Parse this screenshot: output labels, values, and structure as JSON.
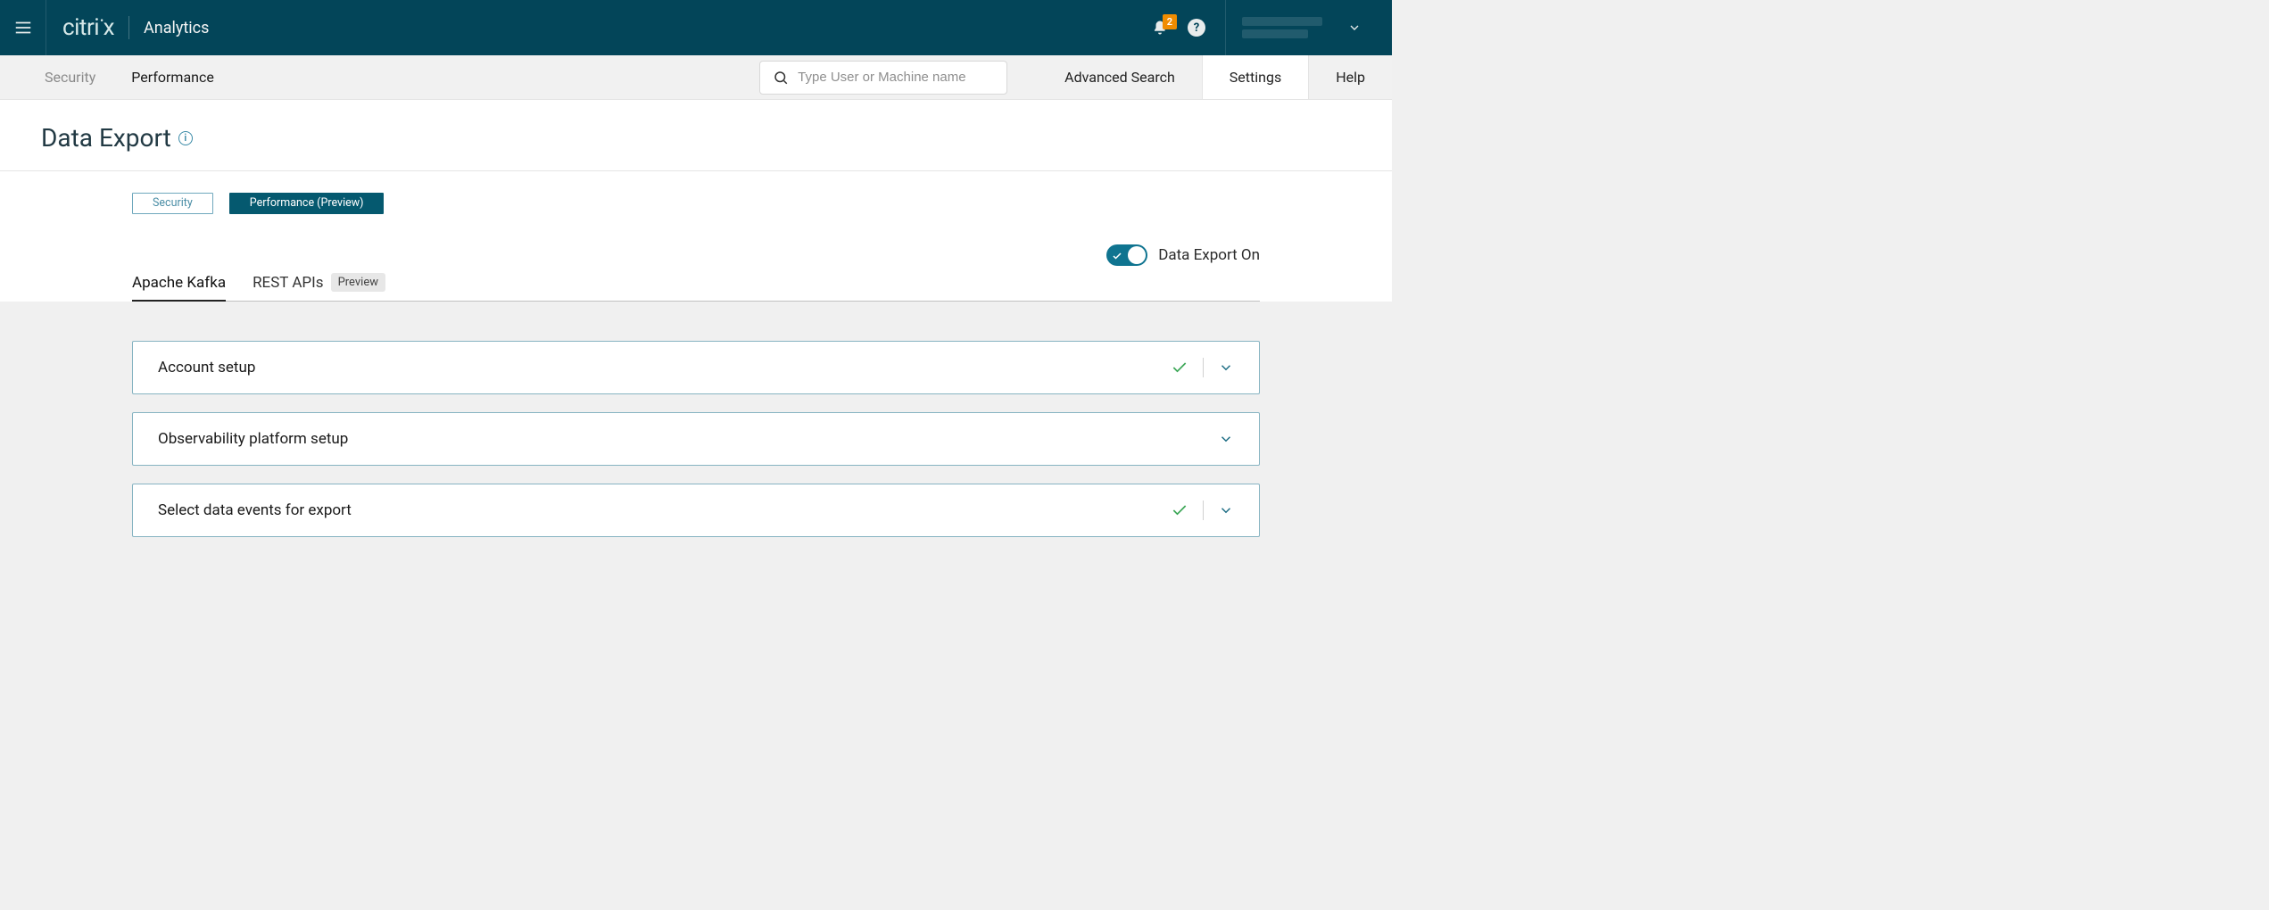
{
  "brand": {
    "logo_text": "citri",
    "logo_dot": "•",
    "logo_x": "x",
    "product": "Analytics"
  },
  "notifications": {
    "count": "2"
  },
  "secnav": {
    "tabs": {
      "security": "Security",
      "performance": "Performance"
    },
    "search_placeholder": "Type User or Machine name",
    "links": {
      "advanced": "Advanced Search",
      "settings": "Settings",
      "help": "Help"
    }
  },
  "page": {
    "title": "Data Export"
  },
  "pill_tabs": {
    "security": "Security",
    "performance": "Performance (Preview)"
  },
  "toggle": {
    "label": "Data Export On"
  },
  "sub_tabs": {
    "kafka": "Apache Kafka",
    "rest": "REST APIs",
    "preview": "Preview"
  },
  "accordions": {
    "account": "Account setup",
    "observability": "Observability platform setup",
    "events": "Select data events for export"
  }
}
